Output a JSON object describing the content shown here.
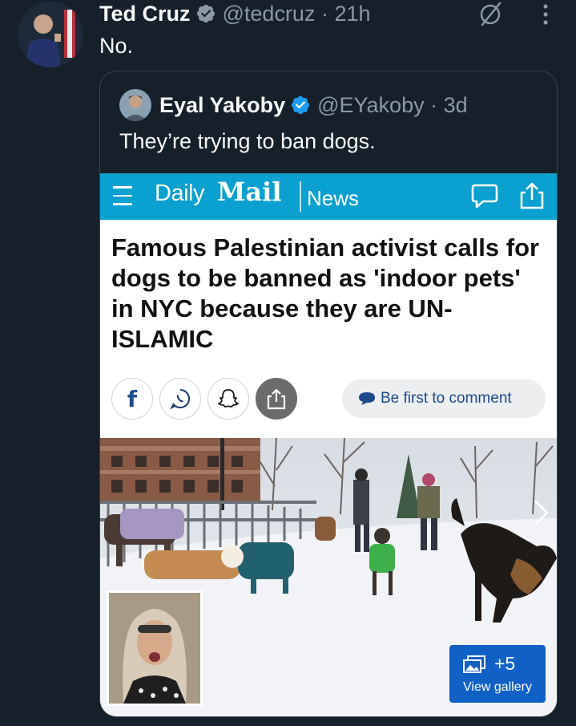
{
  "tweet": {
    "author_name": "Ted Cruz",
    "handle_time": "@tedcruz · 21h",
    "text": "No."
  },
  "quoted_tweet": {
    "author_name": "Eyal Yakoby",
    "handle_time": "@EYakoby · 3d",
    "text": "They’re trying to ban dogs."
  },
  "article": {
    "brand_daily": "Daily",
    "brand_mail": "Mail",
    "section": "News",
    "headline": "Famous Palestinian activist calls for dogs to be banned as 'indoor pets' in NYC because they are UN-ISLAMIC",
    "facebook_glyph": "f",
    "comment_cta": "Be first to comment",
    "gallery_count": "+5",
    "gallery_label": "View gallery"
  },
  "colors": {
    "background": "#15202b",
    "verified": "#1d9bf0",
    "dailymail_bar": "#0aa0cf",
    "gallery_button": "#1160c6"
  },
  "icons": [
    "verified-badge-icon",
    "grok-icon",
    "more-icon",
    "hamburger-icon",
    "comment-icon",
    "share-icon",
    "facebook-icon",
    "whatsapp-icon",
    "snapchat-icon",
    "chevron-right-icon",
    "gallery-icon"
  ]
}
